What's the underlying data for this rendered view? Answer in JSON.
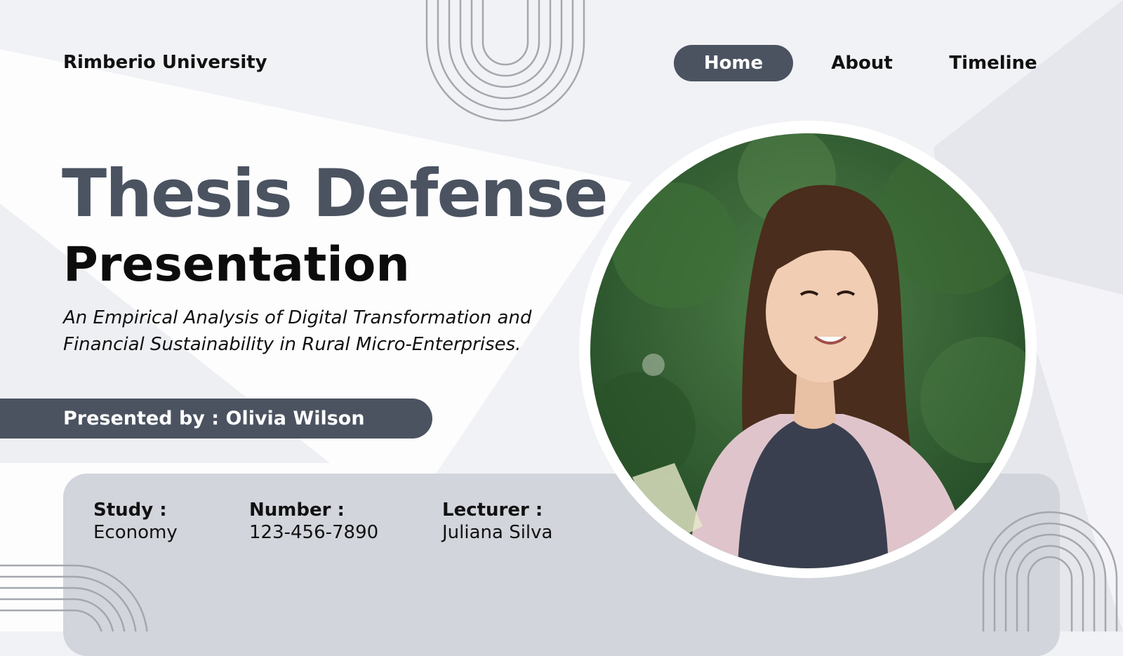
{
  "header": {
    "brand": "Rimberio University",
    "nav": [
      {
        "label": "Home",
        "active": true
      },
      {
        "label": "About",
        "active": false
      },
      {
        "label": "Timeline",
        "active": false
      }
    ]
  },
  "hero": {
    "title_line1": "Thesis Defense",
    "title_line2": "Presentation",
    "subtitle_line1": "An Empirical Analysis of Digital Transformation and",
    "subtitle_line2": "Financial Sustainability in Rural Micro-Enterprises.",
    "presenter": "Presented by : Olivia Wilson"
  },
  "info": {
    "study": {
      "label": "Study :",
      "value": "Economy"
    },
    "number": {
      "label": "Number :",
      "value": "123-456-7890"
    },
    "lecturer": {
      "label": "Lecturer :",
      "value": "Juliana Silva"
    }
  },
  "colors": {
    "accent": "#4b5361",
    "panel": "#d2d5db",
    "background": "#f1f2f6"
  }
}
